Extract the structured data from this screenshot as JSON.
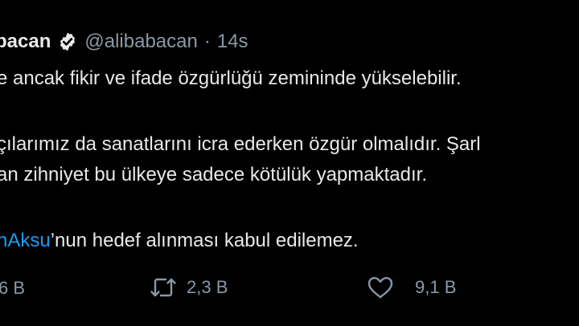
{
  "tweet": {
    "display_name": "bacan",
    "handle": "@alibabacan",
    "separator": "·",
    "time": "14s",
    "lines": [
      "e ancak fikir ve ifade özgürlüğü zemininde yükselebilir.",
      "çılarımız da sanatlarını icra ederken özgür olmalıdır. Şarl",
      "an zihniyet bu ülkeye sadece kötülük yapmaktadır."
    ],
    "mention": "nAksu",
    "last_line_rest": "’nun hedef alınması kabul edilemez."
  },
  "actions": {
    "reply_count": "6 B",
    "retweet_count": "2,3 B",
    "like_count": "9,1 B"
  },
  "colors": {
    "background": "#000000",
    "text": "#e7e9ea",
    "muted": "#8b98a5",
    "link": "#1d9bf0"
  },
  "icons": [
    "verified-badge-icon",
    "retweet-icon",
    "like-heart-icon"
  ]
}
